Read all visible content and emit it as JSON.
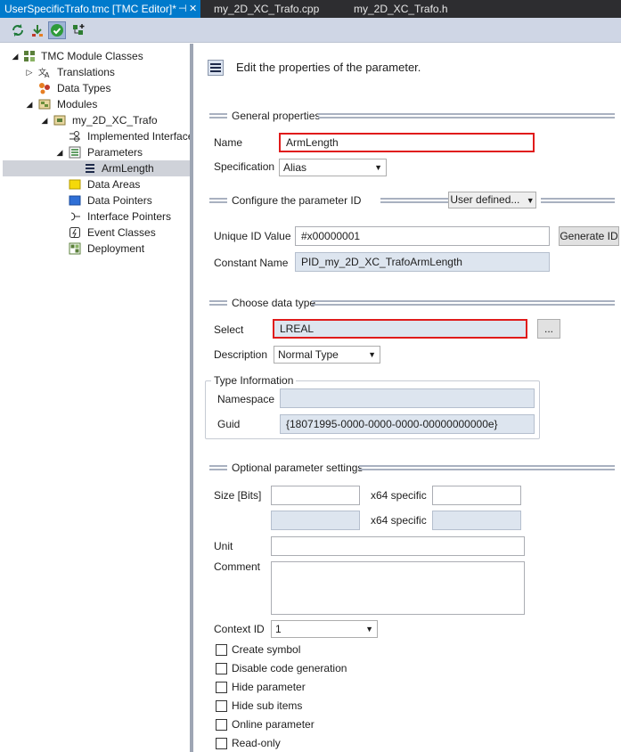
{
  "tabs": [
    {
      "label": "UserSpecificTrafo.tmc [TMC Editor]*",
      "pin": "⊣"
    },
    {
      "label": "my_2D_XC_Trafo.cpp"
    },
    {
      "label": "my_2D_XC_Trafo.h"
    }
  ],
  "tab_close_glyph": "✕",
  "toolbar": {
    "icons": [
      "refresh-icon",
      "merge-icon",
      "check-icon",
      "add-tree-icon"
    ]
  },
  "tree": {
    "items": [
      {
        "label": "TMC Module Classes",
        "icon": "tree-root-icon",
        "expanded": true
      },
      {
        "label": "Translations",
        "icon": "translate-icon",
        "expanded": false
      },
      {
        "label": "Data Types",
        "icon": "data-types-icon"
      },
      {
        "label": "Modules",
        "icon": "modules-icon",
        "expanded": true
      },
      {
        "label": "my_2D_XC_Trafo",
        "icon": "module-icon",
        "expanded": true
      },
      {
        "label": "Implemented Interfaces",
        "icon": "interface-icon"
      },
      {
        "label": "Parameters",
        "icon": "parameters-icon",
        "expanded": true
      },
      {
        "label": "ArmLength",
        "icon": "parameter-icon",
        "selected": true
      },
      {
        "label": "Data Areas",
        "icon": "data-areas-icon"
      },
      {
        "label": "Data Pointers",
        "icon": "data-pointers-icon"
      },
      {
        "label": "Interface Pointers",
        "icon": "interface-pointers-icon"
      },
      {
        "label": "Event Classes",
        "icon": "event-classes-icon"
      },
      {
        "label": "Deployment",
        "icon": "deployment-icon"
      }
    ]
  },
  "editor": {
    "header": "Edit the properties of the parameter.",
    "general": {
      "title": "General properties",
      "name_label": "Name",
      "name_value": "ArmLength",
      "spec_label": "Specification",
      "spec_value": "Alias"
    },
    "paramid": {
      "title": "Configure the parameter ID",
      "mode": "User defined...",
      "unique_label": "Unique ID Value",
      "unique_value": "#x00000001",
      "generate_label": "Generate ID",
      "const_label": "Constant Name",
      "const_value": "PID_my_2D_XC_TrafoArmLength"
    },
    "datatype": {
      "title": "Choose data type",
      "select_label": "Select",
      "select_value": "LREAL",
      "browse_label": "...",
      "desc_label": "Description",
      "desc_value": "Normal Type",
      "typeinfo_title": "Type Information",
      "ns_label": "Namespace",
      "ns_value": "",
      "guid_label": "Guid",
      "guid_value": "{18071995-0000-0000-0000-00000000000e}"
    },
    "optional": {
      "title": "Optional parameter settings",
      "size_label": "Size [Bits]",
      "x64_label": "x64 specific",
      "unit_label": "Unit",
      "comment_label": "Comment",
      "context_label": "Context ID",
      "context_value": "1",
      "checkboxes": [
        {
          "label": "Create symbol",
          "checked": false
        },
        {
          "label": "Disable code generation",
          "checked": false
        },
        {
          "label": "Hide parameter",
          "checked": false
        },
        {
          "label": "Hide sub items",
          "checked": false
        },
        {
          "label": "Online parameter",
          "checked": false
        },
        {
          "label": "Read-only",
          "checked": false
        }
      ]
    }
  },
  "colors": {
    "accent": "#007acc",
    "highlight_border": "#e01b1b",
    "selection": "#cfd2d9"
  }
}
